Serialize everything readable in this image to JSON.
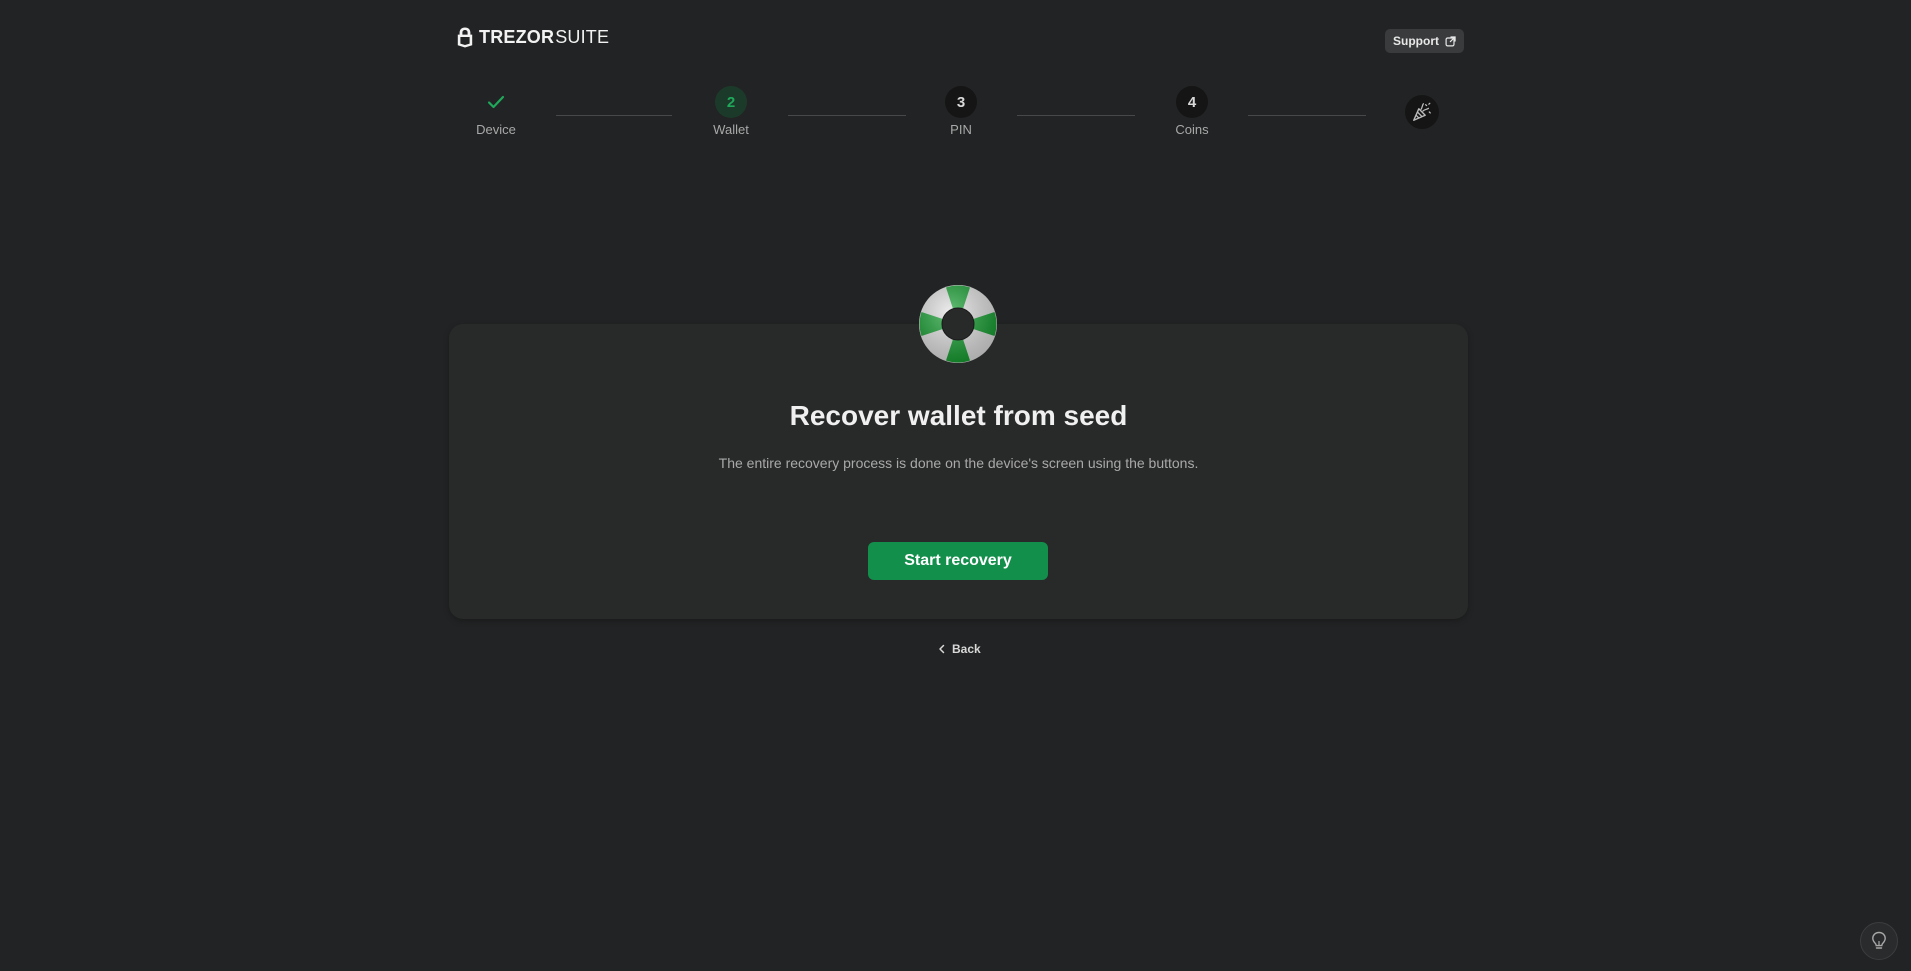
{
  "header": {
    "logo_brand": "TREZOR",
    "logo_suite": "SUITE",
    "support_label": "Support"
  },
  "stepper": {
    "steps": [
      {
        "number": "",
        "label": "Device",
        "state": "done"
      },
      {
        "number": "2",
        "label": "Wallet",
        "state": "active"
      },
      {
        "number": "3",
        "label": "PIN",
        "state": "pending"
      },
      {
        "number": "4",
        "label": "Coins",
        "state": "pending"
      }
    ],
    "final_icon": "party-popper-icon"
  },
  "card": {
    "icon": "lifebuoy-icon",
    "title": "Recover wallet from seed",
    "description": "The entire recovery process is done on the device's screen using the buttons.",
    "button_label": "Start recovery"
  },
  "footer": {
    "back_label": "Back"
  },
  "colors": {
    "background": "#222324",
    "card": "#282929",
    "accent_green": "#138f4c",
    "step_green": "#1fa85a"
  }
}
